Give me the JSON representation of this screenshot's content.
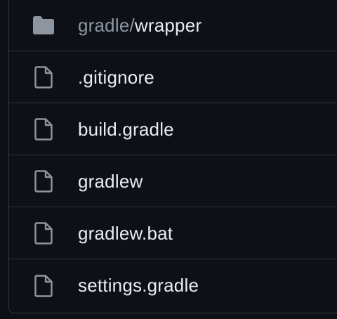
{
  "colors": {
    "background": "#0d1117",
    "border": "#30363d",
    "text": "#e6edf3",
    "muted": "#8d96a0",
    "icon": "#8d96a0"
  },
  "files": [
    {
      "icon": "folder-icon",
      "prefix": "gradle/",
      "name": "wrapper"
    },
    {
      "icon": "file-icon",
      "name": ".gitignore"
    },
    {
      "icon": "file-icon",
      "name": "build.gradle"
    },
    {
      "icon": "file-icon",
      "name": "gradlew"
    },
    {
      "icon": "file-icon",
      "name": "gradlew.bat"
    },
    {
      "icon": "file-icon",
      "name": "settings.gradle"
    }
  ]
}
